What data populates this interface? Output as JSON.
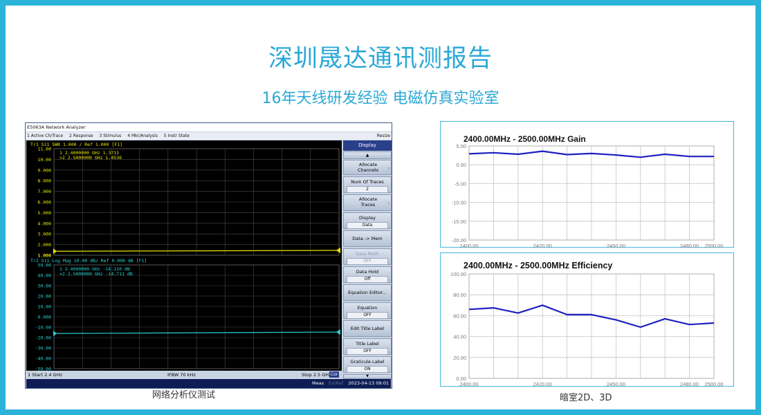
{
  "header": {
    "title": "深圳晟达通讯测报告",
    "subtitle": "16年天线研发经验 电磁仿真实验室"
  },
  "analyzer": {
    "window_title": "E5063A Network Analyzer",
    "menu": [
      "1 Active Ch/Trace",
      "2 Response",
      "3 Stimulus",
      "4 Mkr/Analysis",
      "5 Instr State"
    ],
    "menu_resize": "Resize",
    "trace1_header": "Tr1 S11 SWR 1.000 / Ref 1.000  [F1]",
    "trace1_markers": [
      "1   2.4000000 GHz  1.3711",
      ">2  2.5000000 GHz  1.4536"
    ],
    "trace1_ticks": [
      "11.00",
      "10.00",
      "9.000",
      "8.000",
      "7.000",
      "6.000",
      "5.000",
      "4.000",
      "3.000",
      "2.000",
      "1.000"
    ],
    "trace2_header": "Tr2 S11 Log Mag 10.00 dB/ Ref 0.000 dB [F1]",
    "trace2_markers": [
      "1   2.4000000 GHz -16.110 dB",
      ">2  2.5000000 GHz -14.711 dB"
    ],
    "trace2_ticks": [
      "50.00",
      "40.00",
      "30.00",
      "20.00",
      "10.00",
      "0.000",
      "-10.00",
      "-20.00",
      "-30.00",
      "-40.00",
      "-50.00"
    ],
    "bottom": {
      "start": "1  Start 2.4 GHz",
      "ifbw": "IFBW 70 kHz",
      "stop": "Stop 2.5 GHz",
      "cor": "Cor"
    },
    "status": {
      "meas": "Meas",
      "extref": "ExtRef",
      "time": "2023-04-13 09:01"
    },
    "softkeys": {
      "header": "Display",
      "allocate_channels": "Allocate Channels",
      "num_traces_label": "Num Of Traces",
      "num_traces_value": "2",
      "allocate_traces": "Allocate Traces",
      "display_label": "Display",
      "display_value": "Data",
      "data_mem": "Data -> Mem",
      "data_math_label": "Data Math",
      "data_math_value": "OFF",
      "data_hold_label": "Data Hold",
      "data_hold_value": "Off",
      "equation_editor": "Equation Editor...",
      "equation_label": "Equation",
      "equation_value": "OFF",
      "edit_title_label": "Edit Title Label",
      "title_label_label": "Title Label",
      "title_label_value": "OFF",
      "graticule_label_label": "Graticule Label",
      "graticule_label_value": "ON"
    },
    "caption": "网络分析仪测试",
    "colors": {
      "trace1": "#e8e800",
      "trace2": "#2ad4d4",
      "screen_bg": "#000000"
    },
    "chart_data": [
      {
        "type": "line",
        "name": "S11 SWR",
        "x": [
          2.4,
          2.5
        ],
        "values": [
          1.3711,
          1.4536
        ],
        "ylim": [
          1,
          11
        ]
      },
      {
        "type": "line",
        "name": "S11 Log Mag",
        "x": [
          2.4,
          2.5
        ],
        "values": [
          -16.11,
          -14.711
        ],
        "ylim": [
          -50,
          50
        ]
      }
    ]
  },
  "chart_data": [
    {
      "type": "line",
      "title": "2400.00MHz - 2500.00MHz Gain",
      "x": [
        2400,
        2410,
        2420,
        2430,
        2440,
        2450,
        2460,
        2470,
        2480,
        2490,
        2500
      ],
      "values": [
        2.9,
        3.2,
        2.8,
        3.6,
        2.7,
        3.0,
        2.6,
        2.0,
        2.8,
        2.2,
        2.2
      ],
      "xticks": [
        "2400.00",
        "2420.00",
        "2450.00",
        "2480.00",
        "2500.00"
      ],
      "yticks": [
        "5.00",
        "0.00",
        "-5.00",
        "-10.00",
        "-15.00",
        "-20.00"
      ],
      "ylim": [
        -20,
        5
      ],
      "grid": true,
      "color": "#1f1fc0"
    },
    {
      "type": "line",
      "title": "2400.00MHz - 2500.00MHz Efficiency",
      "x": [
        2400,
        2410,
        2420,
        2430,
        2440,
        2450,
        2460,
        2470,
        2480,
        2490,
        2500
      ],
      "values": [
        66,
        67.5,
        62.5,
        70,
        61,
        61,
        56,
        49,
        57,
        51.5,
        53
      ],
      "xticks": [
        "2400.00",
        "2420.00",
        "2420.00",
        "2450.00",
        "2480.00",
        "2500.00"
      ],
      "yticks": [
        "100.00",
        "80.00",
        "60.00",
        "40.00",
        "20.00",
        "0.00"
      ],
      "ylim": [
        0,
        100
      ],
      "grid": true,
      "color": "#1f1fc0"
    }
  ],
  "caption_right": "暗室2D、3D"
}
